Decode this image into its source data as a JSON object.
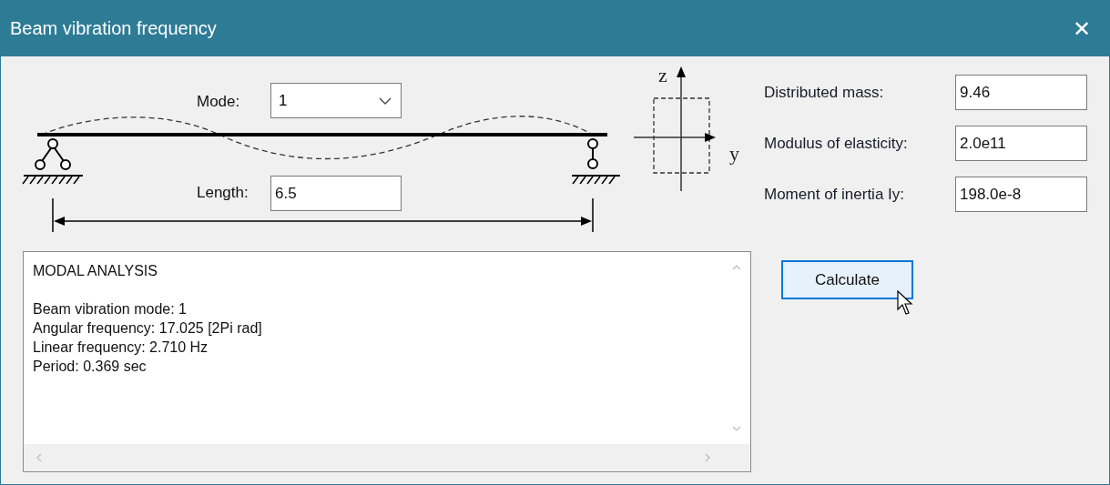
{
  "window": {
    "title": "Beam vibration frequency",
    "close": "✕"
  },
  "beam": {
    "mode_label": "Mode:",
    "mode_value": "1",
    "length_label": "Length:",
    "length_value": "6.5"
  },
  "axes": {
    "z_label": "z",
    "y_label": "y"
  },
  "properties": [
    {
      "label": "Distributed mass:",
      "value": "9.46"
    },
    {
      "label": "Modulus of elasticity:",
      "value": "2.0e11"
    },
    {
      "label": "Moment of inertia Iy:",
      "value": "198.0e-8"
    }
  ],
  "output": {
    "heading": "MODAL ANALYSIS",
    "lines": [
      "Beam vibration mode: 1",
      "Angular frequency: 17.025 [2Pi rad]",
      "Linear frequency: 2.710 Hz",
      "Period: 0.369 sec"
    ]
  },
  "buttons": [
    {
      "label": "Calculate",
      "hovered": true
    }
  ]
}
